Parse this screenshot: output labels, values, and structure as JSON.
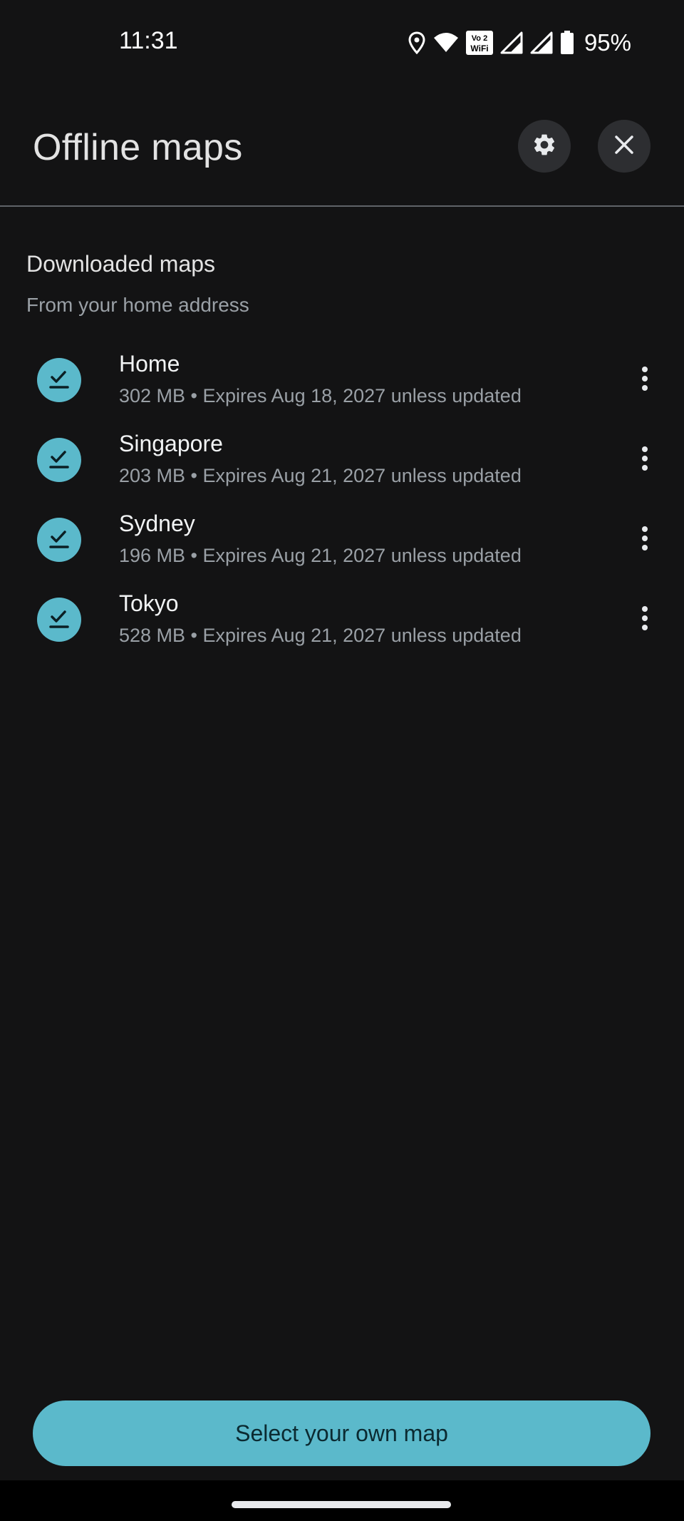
{
  "status_bar": {
    "time": "11:31",
    "battery_percent": "95%",
    "icons": [
      "location-icon",
      "wifi-icon",
      "vowifi-icon",
      "signal-icon",
      "signal-icon",
      "battery-icon"
    ],
    "vowifi_text_top": "Vo 2",
    "vowifi_text_bottom": "WiFi"
  },
  "header": {
    "title": "Offline maps",
    "settings_icon": "gear-icon",
    "close_icon": "close-icon"
  },
  "section": {
    "title": "Downloaded maps",
    "subtitle": "From your home address"
  },
  "maps": [
    {
      "name": "Home",
      "details": "302 MB • Expires Aug 18, 2027 unless updated"
    },
    {
      "name": "Singapore",
      "details": "203 MB • Expires Aug 21, 2027 unless updated"
    },
    {
      "name": "Sydney",
      "details": "196 MB • Expires Aug 21, 2027 unless updated"
    },
    {
      "name": "Tokyo",
      "details": "528 MB • Expires Aug 21, 2027 unless updated"
    }
  ],
  "footer": {
    "button_label": "Select your own map"
  },
  "colors": {
    "background": "#131314",
    "accent": "#5bb9cb",
    "divider": "#5f6368",
    "secondary_text": "#9aa0a6"
  }
}
